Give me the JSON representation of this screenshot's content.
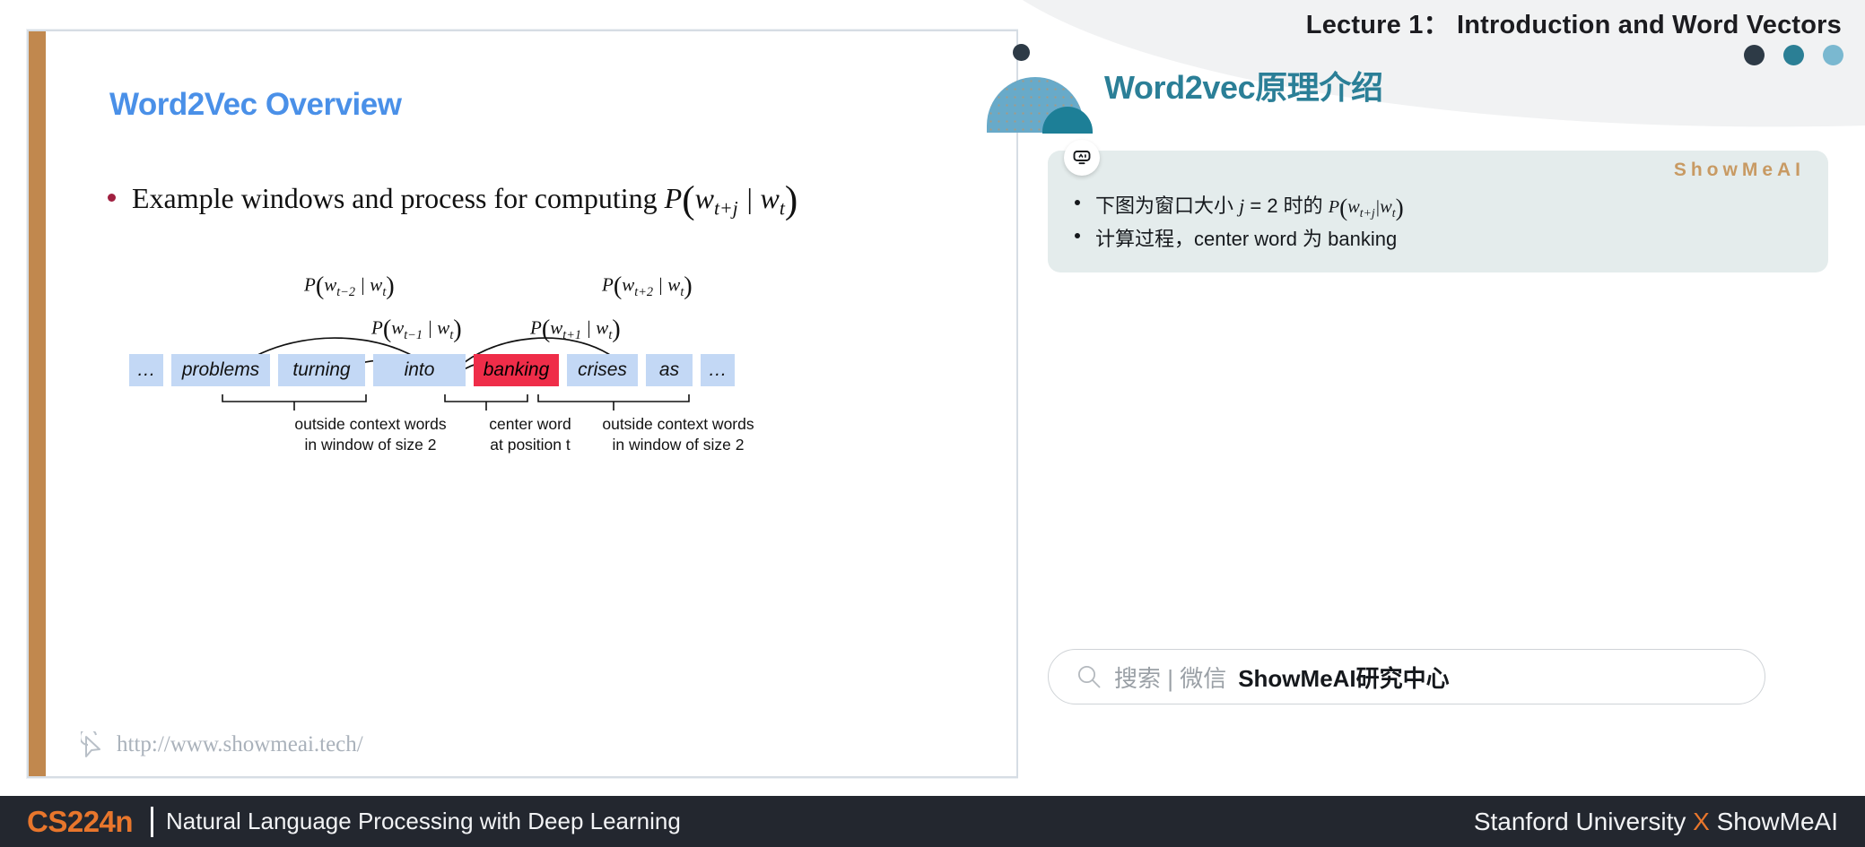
{
  "slide": {
    "title": "Word2Vec Overview",
    "bullet": {
      "prefix": "Example windows and process for computing ",
      "formula_P": "P",
      "formula_open": "(",
      "formula_w1": "w",
      "formula_sub1": "t+j",
      "formula_bar": " | ",
      "formula_w2": "w",
      "formula_sub2": "t",
      "formula_close": ")"
    },
    "url": "http://www.showmeai.tech/",
    "accent_color": "#c1884e",
    "title_color": "#4a90e8"
  },
  "diagram": {
    "prob_labels": [
      {
        "id": "t-2",
        "text": "P(w",
        "sub": "t−2",
        "tail": " | w",
        "tail_sub": "t",
        "close": ")"
      },
      {
        "id": "t-1",
        "text": "P(w",
        "sub": "t−1",
        "tail": " | w",
        "tail_sub": "t",
        "close": ")"
      },
      {
        "id": "t+1",
        "text": "P(w",
        "sub": "t+1",
        "tail": " | w",
        "tail_sub": "t",
        "close": ")"
      },
      {
        "id": "t+2",
        "text": "P(w",
        "sub": "t+2",
        "tail": " | w",
        "tail_sub": "t",
        "close": ")"
      }
    ],
    "words": [
      {
        "text": "…",
        "role": "ellipsis"
      },
      {
        "text": "problems",
        "role": "context"
      },
      {
        "text": "turning",
        "role": "context"
      },
      {
        "text": "into",
        "role": "context"
      },
      {
        "text": "banking",
        "role": "center"
      },
      {
        "text": "crises",
        "role": "context"
      },
      {
        "text": "as",
        "role": "context"
      },
      {
        "text": "…",
        "role": "ellipsis"
      }
    ],
    "captions": [
      {
        "line1": "outside context words",
        "line2": "in window of size 2"
      },
      {
        "line1": "center word",
        "line2": "at position t"
      },
      {
        "line1": "outside context words",
        "line2": "in window of size 2"
      }
    ],
    "context_box_color": "#c3d8f5",
    "center_box_color": "#ef2d49"
  },
  "right_panel": {
    "lecture_title": "Lecture 1： Introduction and Word Vectors",
    "panel_title": "Word2vec原理介绍",
    "panel_title_color": "#2b7f97",
    "watermark": "ShowMeAI",
    "bullets": [
      {
        "pre": "下图为窗口大小 ",
        "var": "j",
        "eq": " = 2 ",
        "mid": "时的 ",
        "formula": "P(w t+j | w t )"
      },
      {
        "pre": "计算过程，center word 为 banking"
      }
    ],
    "search": {
      "placeholder": "搜索 | 微信",
      "brand": "ShowMeAI研究中心"
    },
    "dots": [
      "#2d3a46",
      "#2b7f95",
      "#7ab8d0"
    ]
  },
  "footer": {
    "course_code": "CS224n",
    "subtitle": "Natural Language Processing with Deep Learning",
    "right_pre": "Stanford University ",
    "right_x": "X",
    "right_post": " ShowMeAI",
    "bg_color": "#23272f",
    "accent_color": "#e8762c"
  }
}
